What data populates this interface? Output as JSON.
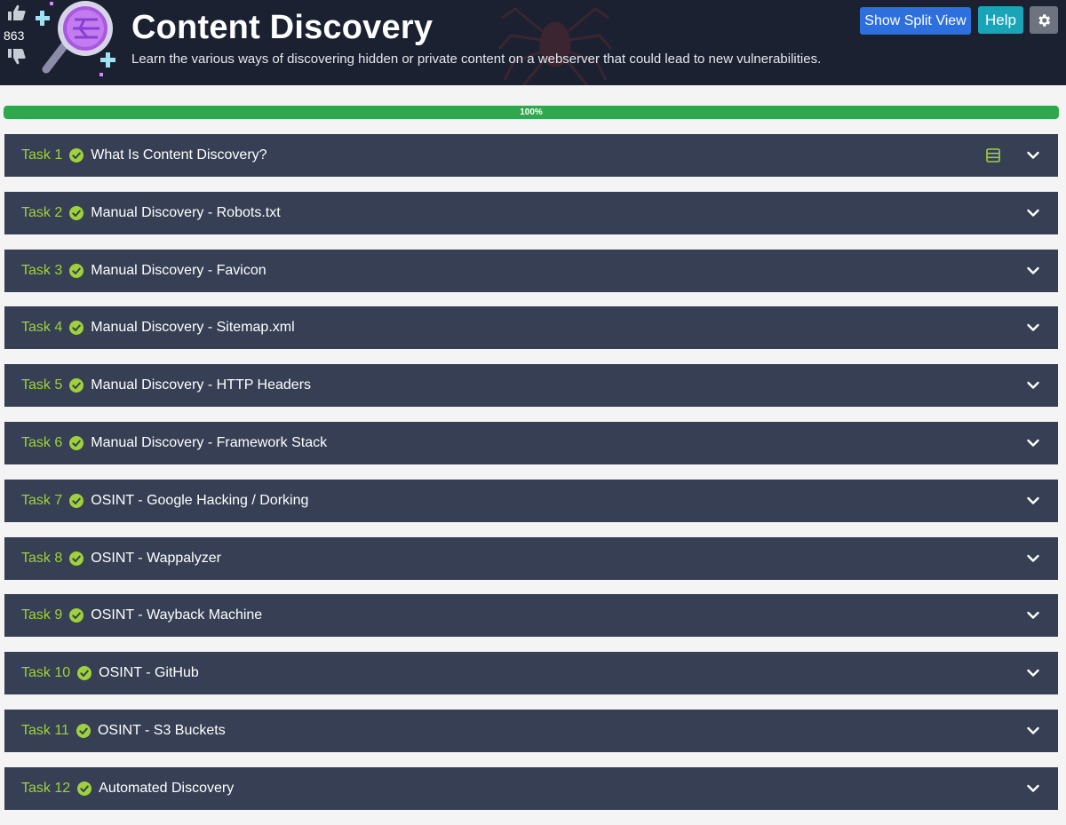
{
  "room": {
    "title": "Content Discovery",
    "subtitle": "Learn the various ways of discovering hidden or private content on a webserver that could lead to new vulnerabilities.",
    "votes": "863"
  },
  "toolbar": {
    "split_label": "Show Split View",
    "help_label": "Help"
  },
  "progress": {
    "value": 1.0,
    "label": "100%"
  },
  "colors": {
    "header_bg": "#1b2130",
    "task_bg": "#363f54",
    "task_number": "#9fd13b",
    "progress_fill": "#2ea84c",
    "split_button": "#2d6fdd",
    "help_button": "#1aa4b8"
  },
  "tasks": [
    {
      "number": "Task 1",
      "name": "What Is Content Discovery?",
      "completed": true,
      "has_notes": true
    },
    {
      "number": "Task 2",
      "name": "Manual Discovery - Robots.txt",
      "completed": true
    },
    {
      "number": "Task 3",
      "name": "Manual Discovery - Favicon",
      "completed": true
    },
    {
      "number": "Task 4",
      "name": "Manual Discovery - Sitemap.xml",
      "completed": true
    },
    {
      "number": "Task 5",
      "name": "Manual Discovery - HTTP Headers",
      "completed": true
    },
    {
      "number": "Task 6",
      "name": "Manual Discovery - Framework Stack",
      "completed": true
    },
    {
      "number": "Task 7",
      "name": "OSINT - Google Hacking / Dorking",
      "completed": true
    },
    {
      "number": "Task 8",
      "name": "OSINT - Wappalyzer",
      "completed": true
    },
    {
      "number": "Task 9",
      "name": "OSINT - Wayback Machine",
      "completed": true
    },
    {
      "number": "Task 10",
      "name": "OSINT - GitHub",
      "completed": true
    },
    {
      "number": "Task 11",
      "name": "OSINT - S3 Buckets",
      "completed": true
    },
    {
      "number": "Task 12",
      "name": "Automated Discovery",
      "completed": true
    }
  ]
}
